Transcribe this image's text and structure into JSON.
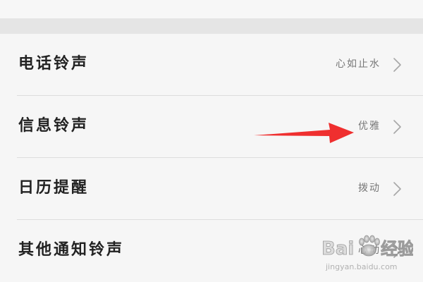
{
  "settings": {
    "items": [
      {
        "label": "电话铃声",
        "value": "心如止水"
      },
      {
        "label": "信息铃声",
        "value": "优雅"
      },
      {
        "label": "日历提醒",
        "value": "拨动"
      },
      {
        "label": "其他通知铃声",
        "value": "心动"
      }
    ]
  },
  "icons": {
    "chevron": "chevron-right-icon",
    "arrow": "red-arrow-icon"
  },
  "colors": {
    "background": "#f4f4f4",
    "section_gap": "#e5e5e5",
    "label": "#222222",
    "value": "#777777",
    "divider": "#dddddd",
    "arrow": "#ef2f2f"
  },
  "watermark": {
    "brand": "Bai经验",
    "url": "jingyan.baidu.com"
  }
}
